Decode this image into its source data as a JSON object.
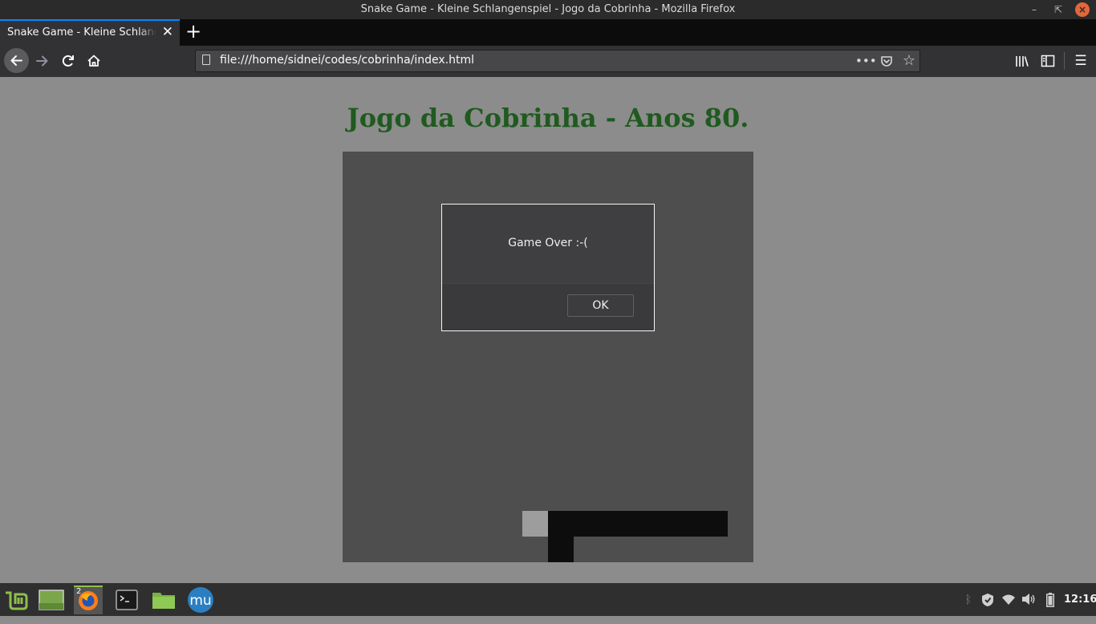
{
  "window": {
    "title": "Snake Game - Kleine Schlangenspiel - Jogo da Cobrinha - Mozilla Firefox",
    "minimize_glyph": "–",
    "restore_glyph": "⇱",
    "close_glyph": "×"
  },
  "tabs": [
    {
      "title": "Snake Game - Kleine Schlangenspiel - Jogo da Cobrinha",
      "close_glyph": "✕",
      "active": true
    }
  ],
  "new_tab_glyph": "+",
  "navbar": {
    "back_icon": "back-arrow-icon",
    "forward_icon": "forward-arrow-icon",
    "reload_icon": "reload-icon",
    "home_icon": "home-icon",
    "url": "file:///home/sidnei/codes/cobrinha/index.html",
    "page_actions_glyph": "•••",
    "pocket_icon": "pocket-icon",
    "bookmark_star_glyph": "☆",
    "library_icon": "library-icon",
    "sidebar_icon": "sidebar-icon",
    "menu_glyph": "☰"
  },
  "page": {
    "heading": "Jogo da Cobrinha - Anos 80.",
    "heading_color": "#1f5a1f",
    "board_color": "#4e4e4e",
    "snake_color": "#0d0d0d",
    "food_color": "#9d9d9d"
  },
  "dialog": {
    "message": "Game Over :-(",
    "ok_label": "OK"
  },
  "taskbar": {
    "items": [
      "mint-menu-icon",
      "show-desktop-icon",
      "firefox-icon",
      "terminal-icon",
      "files-icon",
      "mu-editor-icon"
    ],
    "firefox_badge": "2",
    "tray": [
      "bluetooth-icon",
      "shield-update-icon",
      "wifi-icon",
      "volume-icon",
      "battery-icon"
    ],
    "clock": "12:16"
  }
}
